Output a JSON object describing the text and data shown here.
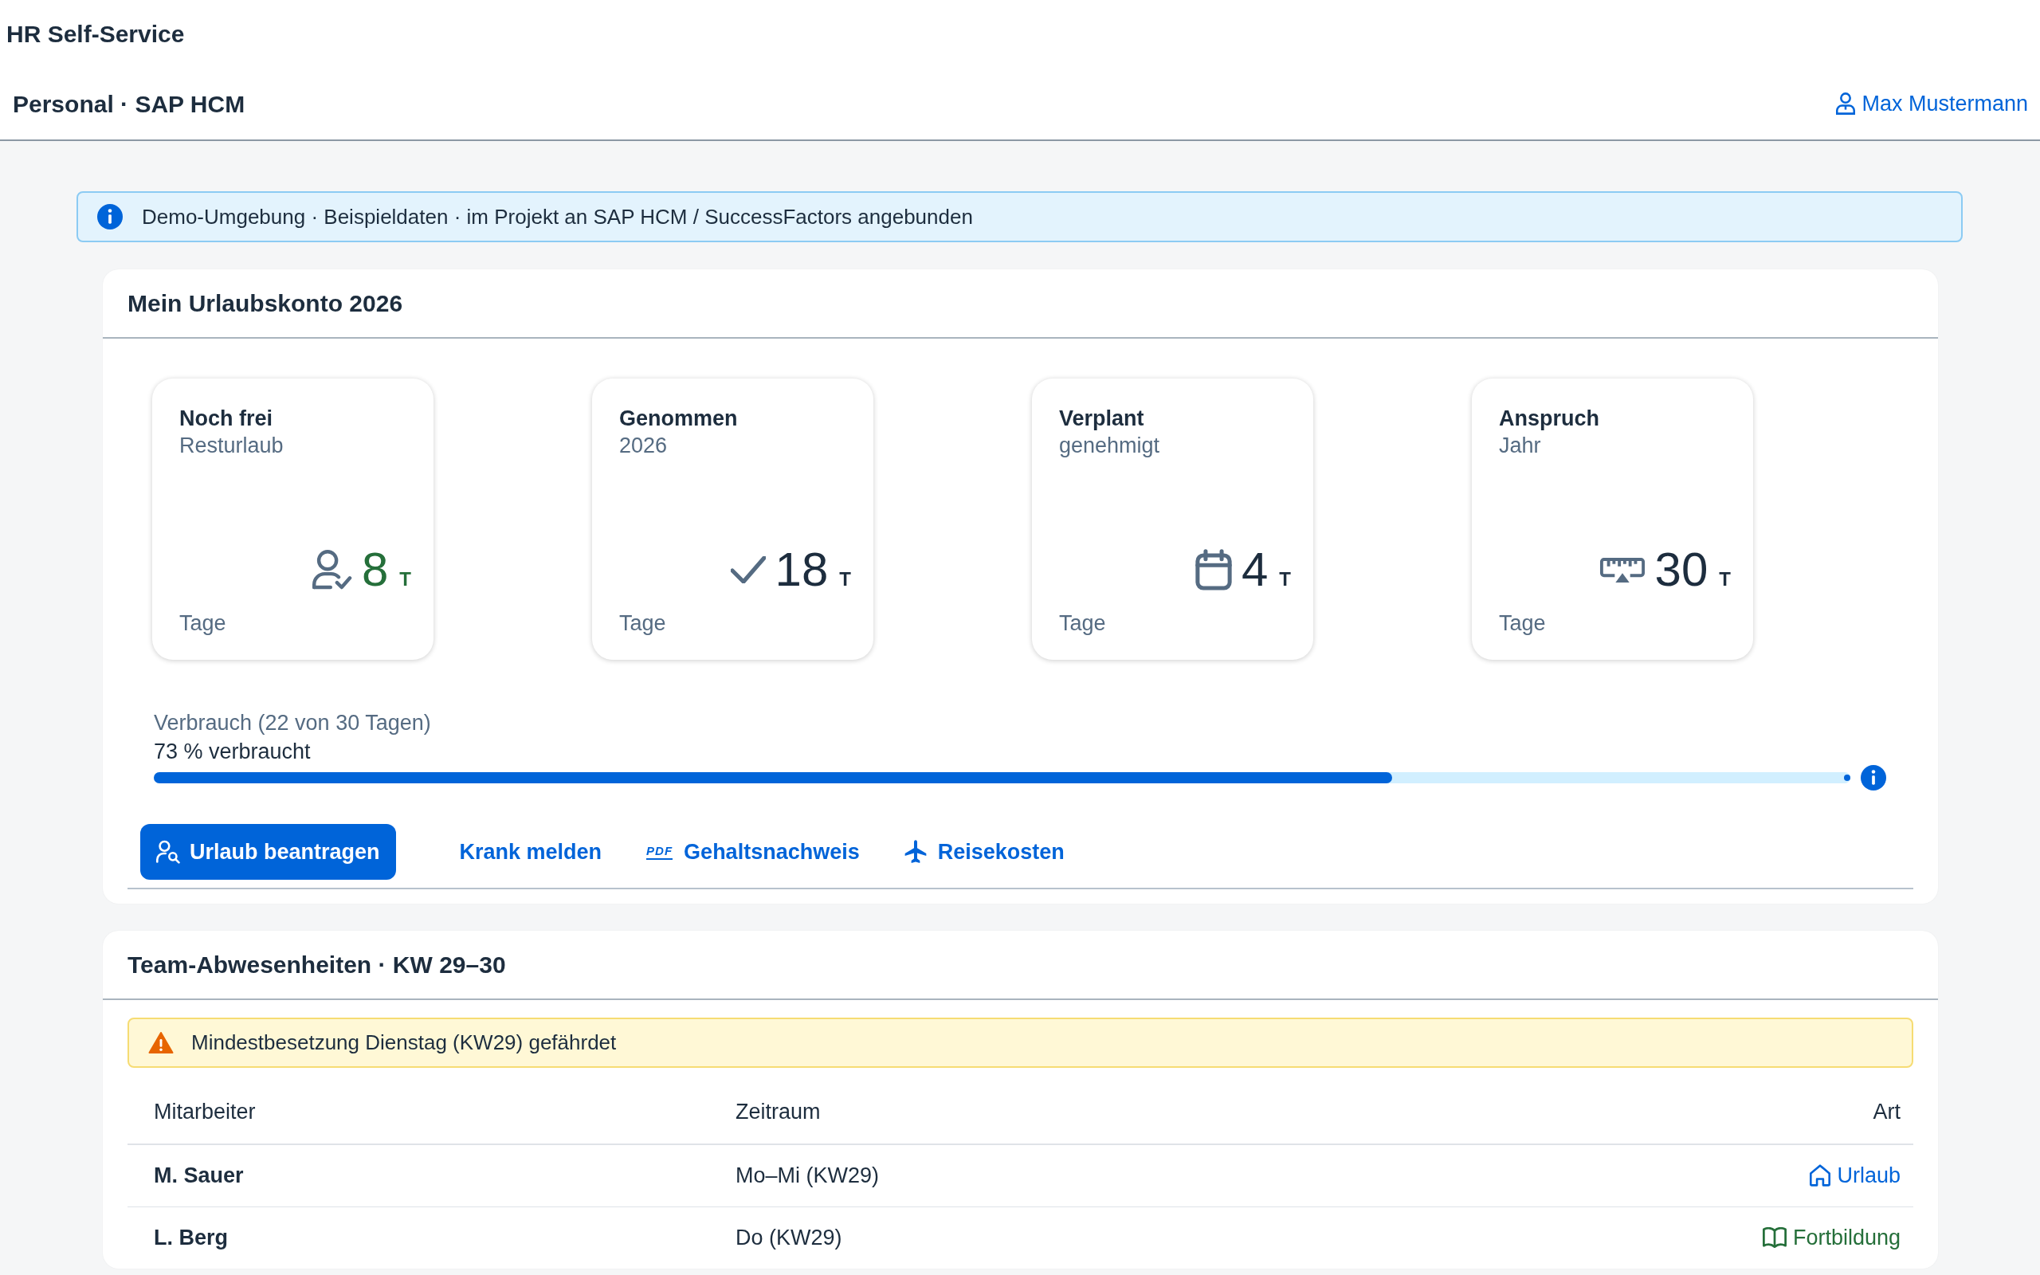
{
  "app_title": "HR Self-Service",
  "header": {
    "title": "Personal · SAP HCM",
    "user": "Max Mustermann"
  },
  "info_banner": "Demo-Umgebung · Beispieldaten · im Projekt an SAP HCM / SuccessFactors angebunden",
  "vacation_account": {
    "title": "Mein Urlaubskonto 2026",
    "tiles": [
      {
        "kind": "free",
        "title": "Noch frei",
        "subtitle": "Resturlaub",
        "value": "8",
        "unit": "T",
        "footer": "Tage",
        "color": "#256f3a"
      },
      {
        "kind": "taken",
        "title": "Genommen",
        "subtitle": "2026",
        "value": "18",
        "unit": "T",
        "footer": "Tage",
        "color": "#1d2d3e"
      },
      {
        "kind": "planned",
        "title": "Verplant",
        "subtitle": "genehmigt",
        "value": "4",
        "unit": "T",
        "footer": "Tage",
        "color": "#1d2d3e"
      },
      {
        "kind": "entitlement",
        "title": "Anspruch",
        "subtitle": "Jahr",
        "value": "30",
        "unit": "T",
        "footer": "Tage",
        "color": "#1d2d3e"
      }
    ],
    "usage": {
      "label": "Verbrauch (22 von 30 Tagen)",
      "reading": "73 % verbraucht",
      "level": 0.73
    },
    "actions": [
      {
        "kind": "primary",
        "label": "Urlaub beantragen"
      },
      {
        "kind": "plain",
        "label": "Krank melden"
      },
      {
        "kind": "document",
        "label": "Gehaltsnachweis",
        "icon_text": "PDF"
      },
      {
        "kind": "travel",
        "label": "Reisekosten"
      }
    ]
  },
  "team_absences": {
    "title": "Team-Abwesenheiten · KW 29–30",
    "warning": "Mindestbesetzung Dienstag (KW29) gefährdet",
    "table": {
      "columns": [
        "Mitarbeiter",
        "Zeitraum",
        "Art"
      ],
      "rows": [
        {
          "employee": "M. Sauer",
          "period": "Mo–Mi (KW29)",
          "type": {
            "kind": "vacation",
            "label": "Urlaub"
          }
        },
        {
          "employee": "L. Berg",
          "period": "Do (KW29)",
          "type": {
            "kind": "training",
            "label": "Fortbildung"
          }
        }
      ]
    }
  }
}
